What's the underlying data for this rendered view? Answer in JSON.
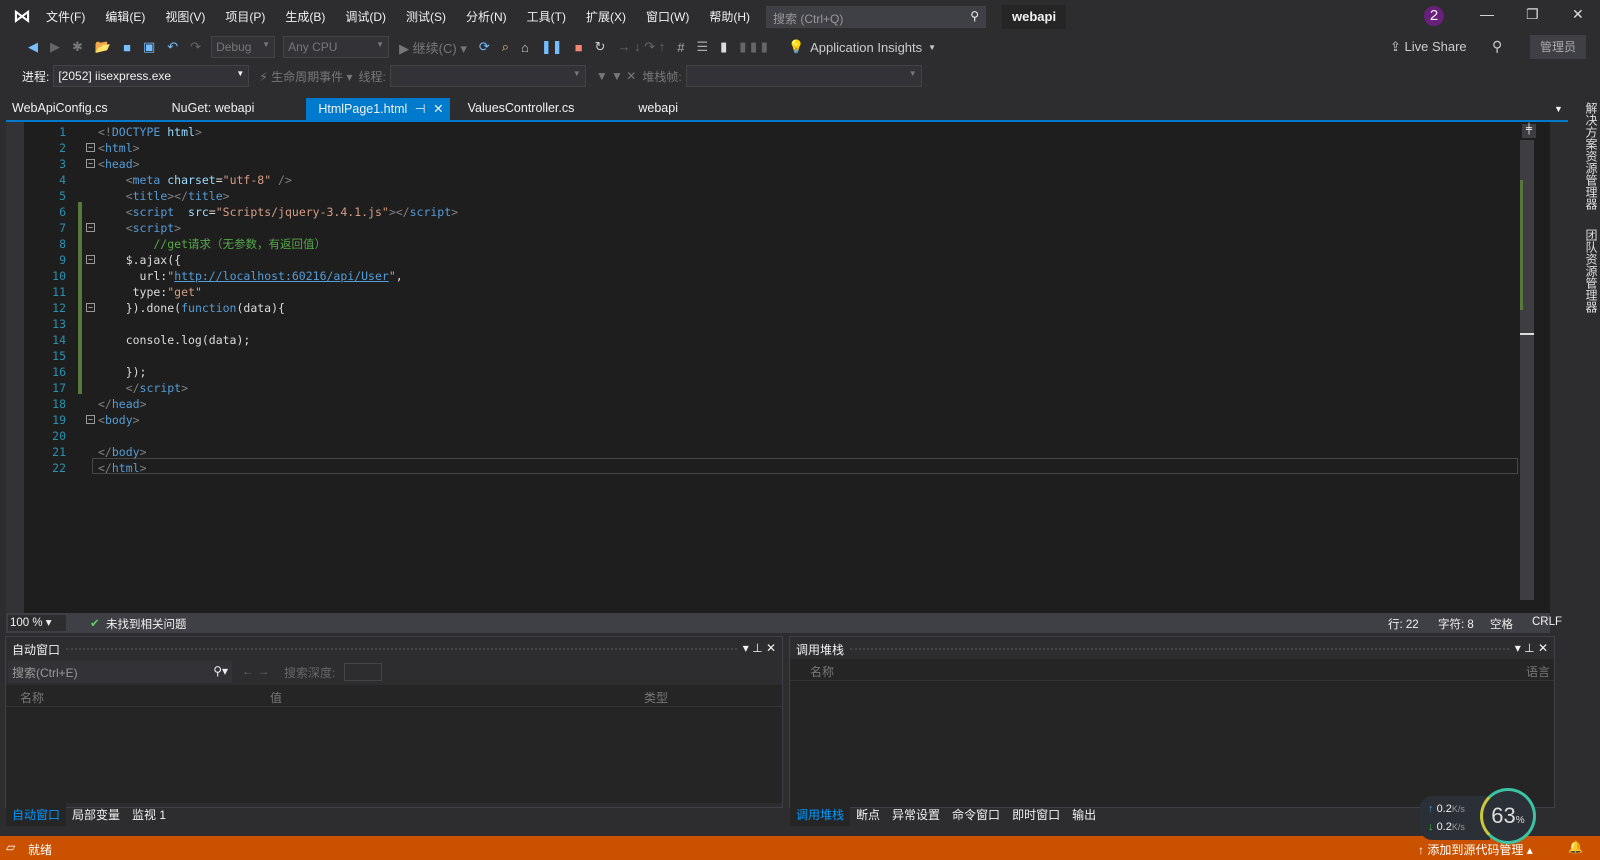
{
  "title_bar": {
    "menu": [
      "文件(F)",
      "编辑(E)",
      "视图(V)",
      "项目(P)",
      "生成(B)",
      "调试(D)",
      "测试(S)",
      "分析(N)",
      "工具(T)",
      "扩展(X)",
      "窗口(W)",
      "帮助(H)"
    ],
    "search_placeholder": "搜索 (Ctrl+Q)",
    "project": "webapi",
    "notifications": "2"
  },
  "toolbar": {
    "config": "Debug",
    "platform": "Any CPU",
    "continue": "继续(C)",
    "app_insights": "Application Insights",
    "live_share": "Live Share",
    "admin": "管理员"
  },
  "toolbar2": {
    "process_label": "进程:",
    "process": "[2052] iisexpress.exe",
    "lifecycle": "生命周期事件",
    "thread_label": "线程:",
    "stack_label": "堆栈帧:"
  },
  "tabs": [
    {
      "label": "WebApiConfig.cs"
    },
    {
      "label": "NuGet: webapi"
    },
    {
      "label": "HtmlPage1.html",
      "active": true
    },
    {
      "label": "ValuesController.cs"
    },
    {
      "label": "webapi"
    }
  ],
  "code": [
    [
      [
        "<!",
        "t-punc"
      ],
      [
        "DOCTYPE ",
        "t-tag"
      ],
      [
        "html",
        "t-attr"
      ],
      [
        ">",
        "t-punc"
      ]
    ],
    [
      [
        "<",
        "t-punc"
      ],
      [
        "html",
        "t-tag"
      ],
      [
        ">",
        "t-punc"
      ]
    ],
    [
      [
        "<",
        "t-punc"
      ],
      [
        "head",
        "t-tag"
      ],
      [
        ">",
        "t-punc"
      ]
    ],
    [
      [
        "    <",
        "t-punc"
      ],
      [
        "meta ",
        "t-tag"
      ],
      [
        "charset",
        "t-attr"
      ],
      [
        "=",
        "t-def"
      ],
      [
        "\"utf-8\"",
        "t-str"
      ],
      [
        " />",
        "t-punc"
      ]
    ],
    [
      [
        "    <",
        "t-punc"
      ],
      [
        "title",
        "t-tag"
      ],
      [
        "></",
        "t-punc"
      ],
      [
        "title",
        "t-tag"
      ],
      [
        ">",
        "t-punc"
      ]
    ],
    [
      [
        "    <",
        "t-punc"
      ],
      [
        "script  ",
        "t-tag"
      ],
      [
        "src",
        "t-attr"
      ],
      [
        "=",
        "t-def"
      ],
      [
        "\"Scripts/jquery-3.4.1.js\"",
        "t-str"
      ],
      [
        "></",
        "t-punc"
      ],
      [
        "script",
        "t-tag"
      ],
      [
        ">",
        "t-punc"
      ]
    ],
    [
      [
        "    <",
        "t-punc"
      ],
      [
        "script",
        "t-tag"
      ],
      [
        ">",
        "t-punc"
      ]
    ],
    [
      [
        "        //get请求（无参数，有返回值）",
        "t-cmt"
      ]
    ],
    [
      [
        "    $.ajax({",
        "t-def"
      ]
    ],
    [
      [
        "      url:",
        "t-def"
      ],
      [
        "\"",
        "t-str"
      ],
      [
        "http://localhost:60216/api/User",
        "t-url"
      ],
      [
        "\"",
        "t-str"
      ],
      [
        ",",
        "t-def"
      ]
    ],
    [
      [
        "     type:",
        "t-def"
      ],
      [
        "\"get\"",
        "t-str"
      ]
    ],
    [
      [
        "    }).done(",
        "t-def"
      ],
      [
        "function",
        "t-kw"
      ],
      [
        "(data){",
        "t-def"
      ]
    ],
    [
      [
        "",
        "t-def"
      ]
    ],
    [
      [
        "    console.log(data);",
        "t-def"
      ]
    ],
    [
      [
        "",
        "t-def"
      ]
    ],
    [
      [
        "    });",
        "t-def"
      ]
    ],
    [
      [
        "    </",
        "t-punc"
      ],
      [
        "script",
        "t-tag"
      ],
      [
        ">",
        "t-punc"
      ]
    ],
    [
      [
        "</",
        "t-punc"
      ],
      [
        "head",
        "t-tag"
      ],
      [
        ">",
        "t-punc"
      ]
    ],
    [
      [
        "<",
        "t-punc"
      ],
      [
        "body",
        "t-tag"
      ],
      [
        ">",
        "t-punc"
      ]
    ],
    [
      [
        "",
        "t-def"
      ]
    ],
    [
      [
        "</",
        "t-punc"
      ],
      [
        "body",
        "t-tag"
      ],
      [
        ">",
        "t-punc"
      ]
    ],
    [
      [
        "</",
        "t-punc"
      ],
      [
        "html",
        "t-tag"
      ],
      [
        ">",
        "t-punc"
      ]
    ]
  ],
  "fold_lines": [
    2,
    3,
    7,
    9,
    12,
    19
  ],
  "editor_status": {
    "zoom": "100 %",
    "issues": "未找到相关问题",
    "line": "行: 22",
    "char": "字符: 8",
    "indent": "空格",
    "eol": "CRLF"
  },
  "autos": {
    "title": "自动窗口",
    "search": "搜索(Ctrl+E)",
    "depth": "搜索深度:",
    "cols": [
      "名称",
      "值",
      "类型"
    ],
    "tabs": [
      "自动窗口",
      "局部变量",
      "监视 1"
    ]
  },
  "callstack": {
    "title": "调用堆栈",
    "cols": [
      "名称",
      "语言"
    ],
    "tabs": [
      "调用堆栈",
      "断点",
      "异常设置",
      "命令窗口",
      "即时窗口",
      "输出"
    ]
  },
  "side": [
    "解决方案资源管理器",
    "团队资源管理器"
  ],
  "status": {
    "ready": "就绪",
    "source_control": "添加到源代码管理"
  },
  "net": {
    "up": "0.2",
    "down": "0.2",
    "unit": "K/s",
    "cpu": "63",
    "pct": "%"
  }
}
